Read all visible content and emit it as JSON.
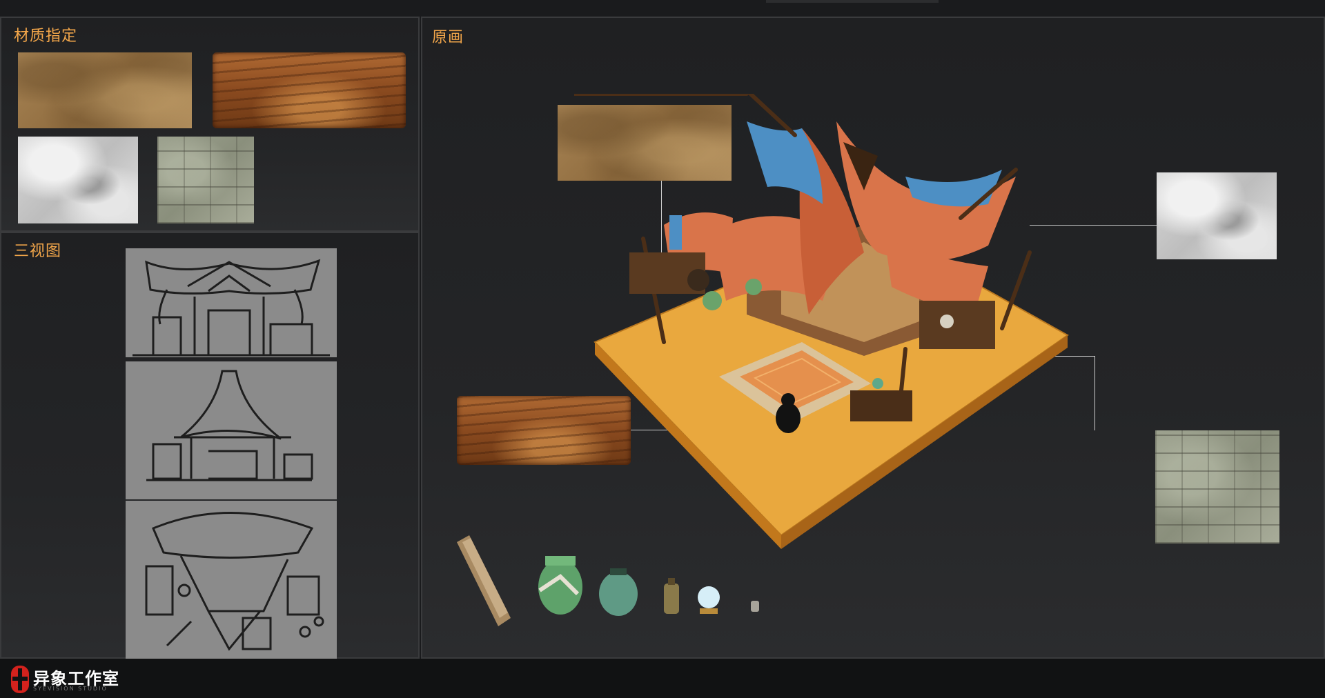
{
  "panels": {
    "materials_title": "材质指定",
    "views_title": "三视图",
    "concept_title": "原画"
  },
  "materials": [
    {
      "name": "sand",
      "type": "sand-texture"
    },
    {
      "name": "wood",
      "type": "wood-texture"
    },
    {
      "name": "cloth",
      "type": "cloth-texture"
    },
    {
      "name": "stone",
      "type": "stone-texture"
    }
  ],
  "logo": {
    "name": "异象工作室",
    "sub": "SYEVISION STUDIO"
  },
  "colors": {
    "title": "#f2a64a",
    "panel_border": "#3a3b3d",
    "ground": "#e9a83e",
    "awning_orange": "#d9744a",
    "awning_blue": "#4d8fc4",
    "logo_red": "#d3221d"
  },
  "props": [
    "plank",
    "green-vase",
    "teal-jar",
    "small-bottle",
    "crystal-ball",
    "tiny-jar"
  ]
}
